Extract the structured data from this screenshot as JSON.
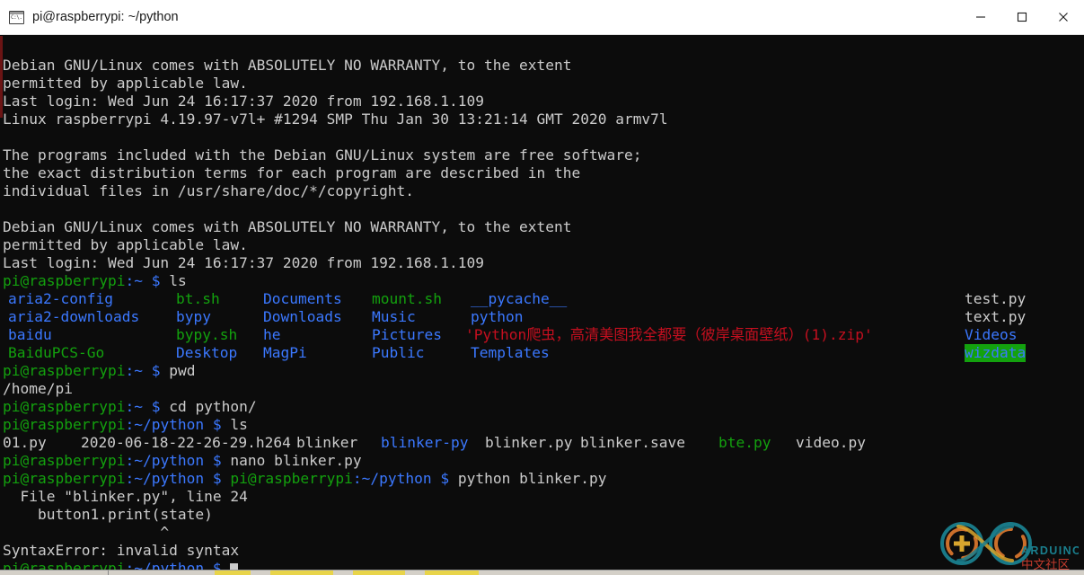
{
  "window": {
    "title": "pi@raspberrypi: ~/python",
    "icon": "terminal-icon",
    "controls": {
      "minimize": "Minimize",
      "maximize": "Maximize",
      "close": "Close"
    }
  },
  "colors": {
    "background": "#0c0c0c",
    "foreground": "#cccccc",
    "green": "#13a10e",
    "blue": "#3b78ff",
    "red": "#c50f1f",
    "titlebar": "#ffffff"
  },
  "terminal": {
    "motd_1": {
      "line1": "Debian GNU/Linux comes with ABSOLUTELY NO WARRANTY, to the extent",
      "line2": "permitted by applicable law.",
      "line3": "Last login: Wed Jun 24 16:17:37 2020 from 192.168.1.109",
      "line4": "Linux raspberrypi 4.19.97-v7l+ #1294 SMP Thu Jan 30 13:21:14 GMT 2020 armv7l"
    },
    "motd_2": {
      "line1": "The programs included with the Debian GNU/Linux system are free software;",
      "line2": "the exact distribution terms for each program are described in the",
      "line3": "individual files in /usr/share/doc/*/copyright."
    },
    "motd_3": {
      "line1": "Debian GNU/Linux comes with ABSOLUTELY NO WARRANTY, to the extent",
      "line2": "permitted by applicable law.",
      "line3": "Last login: Wed Jun 24 16:17:37 2020 from 192.168.1.109"
    },
    "prompt": {
      "user_host": "pi@raspberrypi",
      "colon": ":",
      "path_home": "~",
      "path_python": "~/python",
      "sigil": "$"
    },
    "commands": {
      "ls_home": "ls",
      "pwd": "pwd",
      "pwd_output": "/home/pi",
      "cd_python": "cd python/",
      "ls_python": "ls",
      "nano": "nano blinker.py",
      "python_run": "python blinker.py"
    },
    "ls_home_listing": {
      "col1": [
        {
          "name": "aria2-config",
          "color": "blue"
        },
        {
          "name": "aria2-downloads",
          "color": "blue"
        },
        {
          "name": "baidu",
          "color": "blue"
        },
        {
          "name": "BaiduPCS-Go",
          "color": "green"
        }
      ],
      "col2": [
        {
          "name": "bt.sh",
          "color": "green"
        },
        {
          "name": "bypy",
          "color": "blue"
        },
        {
          "name": "bypy.sh",
          "color": "green"
        },
        {
          "name": "Desktop",
          "color": "blue"
        }
      ],
      "col3": [
        {
          "name": "Documents",
          "color": "blue"
        },
        {
          "name": "Downloads",
          "color": "blue"
        },
        {
          "name": "he",
          "color": "blue"
        },
        {
          "name": "MagPi",
          "color": "blue"
        }
      ],
      "col4": [
        {
          "name": "mount.sh",
          "color": "green"
        },
        {
          "name": "Music",
          "color": "blue"
        },
        {
          "name": "Pictures",
          "color": "blue"
        },
        {
          "name": "Public",
          "color": "blue"
        }
      ],
      "col5": [
        {
          "name": "__pycache__",
          "color": "blue"
        },
        {
          "name": "python",
          "color": "blue"
        },
        {
          "name": "'Python爬虫，高清美图我全都要（彼岸桌面壁纸）(1).zip'",
          "color": "red"
        },
        {
          "name": "Templates",
          "color": "blue"
        }
      ],
      "col6": [
        {
          "name": "test.py",
          "color": "white"
        },
        {
          "name": "text.py",
          "color": "white"
        },
        {
          "name": "Videos",
          "color": "blue"
        },
        {
          "name": "wizdata",
          "color": "bgreen"
        }
      ]
    },
    "ls_python_listing": [
      {
        "name": "01.py",
        "color": "white"
      },
      {
        "name": "2020-06-18-22-26-29.h264",
        "color": "white"
      },
      {
        "name": "blinker",
        "color": "white"
      },
      {
        "name": "blinker-py",
        "color": "blue"
      },
      {
        "name": "blinker.py",
        "color": "white"
      },
      {
        "name": "blinker.save",
        "color": "white"
      },
      {
        "name": "bte.py",
        "color": "green"
      },
      {
        "name": "video.py",
        "color": "white"
      }
    ],
    "traceback": {
      "file_line": "  File \"blinker.py\", line 24",
      "code_line": "    button1.print(state)",
      "caret_line": "                  ^",
      "error": "SyntaxError: invalid syntax"
    }
  },
  "watermark": {
    "brand": "ARDUINO",
    "subtitle": "中文社区"
  }
}
